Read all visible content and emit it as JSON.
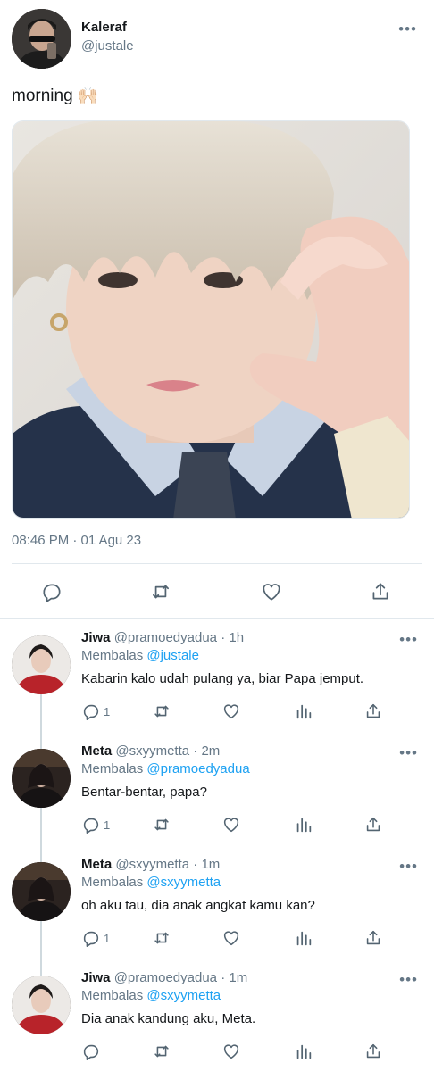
{
  "tweet": {
    "author_name": "Kaleraf",
    "author_handle": "@justale",
    "text": "morning 🙌🏻",
    "timestamp": "08:46 PM · 01 Agu 23",
    "more_icon": "more-dots-icon",
    "actions": [
      "reply-icon",
      "retweet-icon",
      "like-icon",
      "share-icon"
    ]
  },
  "replies": [
    {
      "name": "Jiwa",
      "handle": "@pramoedyadua",
      "dot": "·",
      "time": "1h",
      "replying_label": "Membalas",
      "replying_to": "@justale",
      "text": "Kabarin kalo udah pulang ya, biar Papa jemput.",
      "reply_count": "1",
      "avatar_style": "red-jacket"
    },
    {
      "name": "Meta",
      "handle": "@sxyymetta",
      "dot": "·",
      "time": "2m",
      "replying_label": "Membalas",
      "replying_to": "@pramoedyadua",
      "text": "Bentar-bentar, papa?",
      "reply_count": "1",
      "avatar_style": "dark"
    },
    {
      "name": "Meta",
      "handle": "@sxyymetta",
      "dot": "·",
      "time": "1m",
      "replying_label": "Membalas",
      "replying_to": "@sxyymetta",
      "text": "oh aku tau, dia anak angkat kamu kan?",
      "reply_count": "1",
      "avatar_style": "dark"
    },
    {
      "name": "Jiwa",
      "handle": "@pramoedyadua",
      "dot": "·",
      "time": "1m",
      "replying_label": "Membalas",
      "replying_to": "@sxyymetta",
      "text": "Dia anak kandung aku, Meta.",
      "reply_count": "",
      "avatar_style": "red-jacket"
    }
  ],
  "more_dots": "•••",
  "colors": {
    "text": "#14171a",
    "secondary": "#657786",
    "link": "#1da1f2",
    "divider": "#e1e8ed"
  }
}
